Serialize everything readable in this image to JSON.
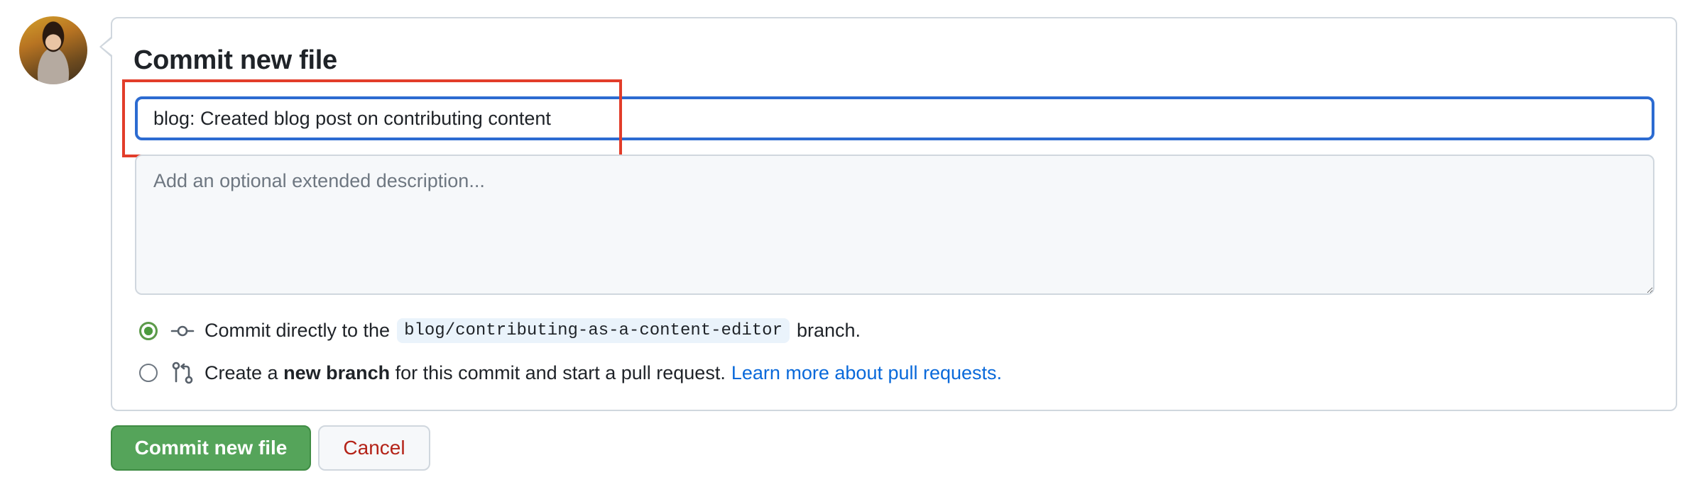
{
  "form": {
    "title": "Commit new file",
    "summary_value": "blog: Created blog post on contributing content",
    "description_placeholder": "Add an optional extended description..."
  },
  "options": {
    "direct": {
      "prefix": "Commit directly to the",
      "branch": "blog/contributing-as-a-content-editor",
      "suffix": "branch.",
      "selected": true,
      "icon": "git-commit-icon"
    },
    "new_branch": {
      "prefix": "Create a",
      "bold": "new branch",
      "suffix": "for this commit and start a pull request.",
      "link": "Learn more about pull requests.",
      "selected": false,
      "icon": "git-pull-request-icon"
    }
  },
  "buttons": {
    "commit": "Commit new file",
    "cancel": "Cancel"
  },
  "colors": {
    "focus_border": "#2c6bd1",
    "highlight_box": "#e23d2a",
    "primary_button": "#55a45a",
    "link": "#0969da",
    "cancel_text": "#b42318"
  }
}
